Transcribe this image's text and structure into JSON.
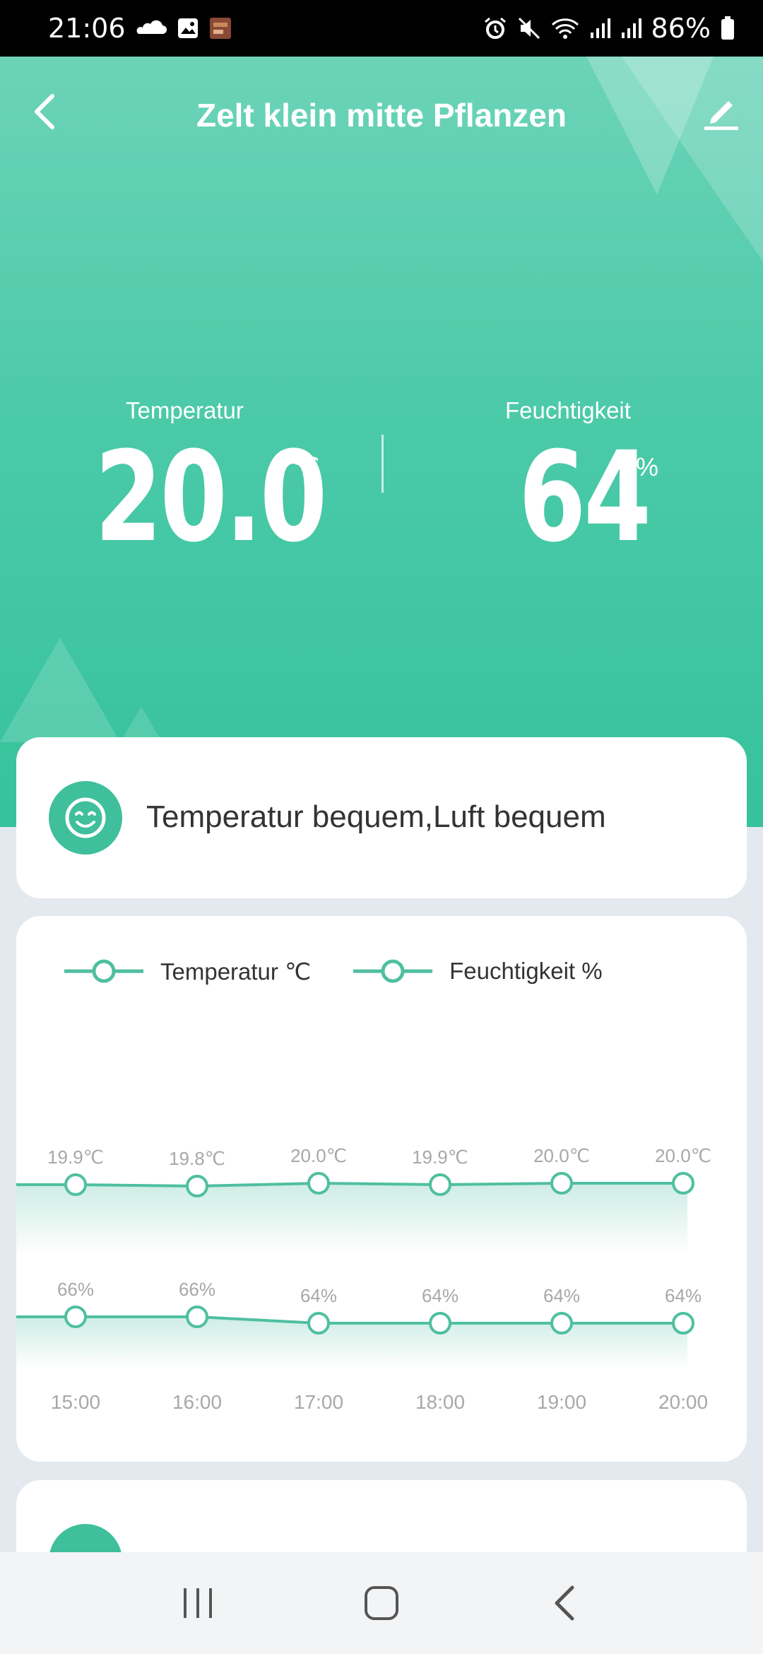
{
  "status_bar": {
    "time": "21:06",
    "battery": "86%",
    "left_icons": [
      "cloud-icon",
      "gallery-icon",
      "app-thumbnail-icon"
    ],
    "right_icons": [
      "alarm-icon",
      "mute-icon",
      "wifi-icon",
      "signal-icon",
      "signal-icon",
      "battery-icon"
    ]
  },
  "header": {
    "title": "Zelt klein mitte Pflanzen",
    "back_icon": "back-arrow-icon",
    "edit_icon": "edit-pencil-icon"
  },
  "readings": {
    "temperature": {
      "label": "Temperatur",
      "value": "20.0",
      "unit": "℃"
    },
    "humidity": {
      "label": "Feuchtigkeit",
      "value": "64",
      "unit": "%"
    }
  },
  "comfort": {
    "icon": "smiley-face-icon",
    "text": "Temperatur bequem,Luft bequem"
  },
  "colors": {
    "accent": "#3fbf9b",
    "line": "#4fbfa0",
    "header_top": "#6cd3b8",
    "header_bottom": "#36c29c"
  },
  "chart_data": {
    "type": "line",
    "x": [
      "15:00",
      "16:00",
      "17:00",
      "18:00",
      "19:00",
      "20:00"
    ],
    "series": [
      {
        "name": "Temperatur ℃",
        "values": [
          19.9,
          19.8,
          20.0,
          19.9,
          20.0,
          20.0
        ],
        "labels": [
          "19.9℃",
          "19.8℃",
          "20.0℃",
          "19.9℃",
          "20.0℃",
          "20.0℃"
        ]
      },
      {
        "name": "Feuchtigkeit %",
        "values": [
          66,
          66,
          64,
          64,
          64,
          64
        ],
        "labels": [
          "66%",
          "66%",
          "64%",
          "64%",
          "64%",
          "64%"
        ]
      }
    ],
    "legend": "top-left",
    "grid": false
  },
  "navigation": {
    "recents_icon": "recents-icon",
    "home_icon": "home-icon",
    "back_icon": "nav-back-icon"
  }
}
